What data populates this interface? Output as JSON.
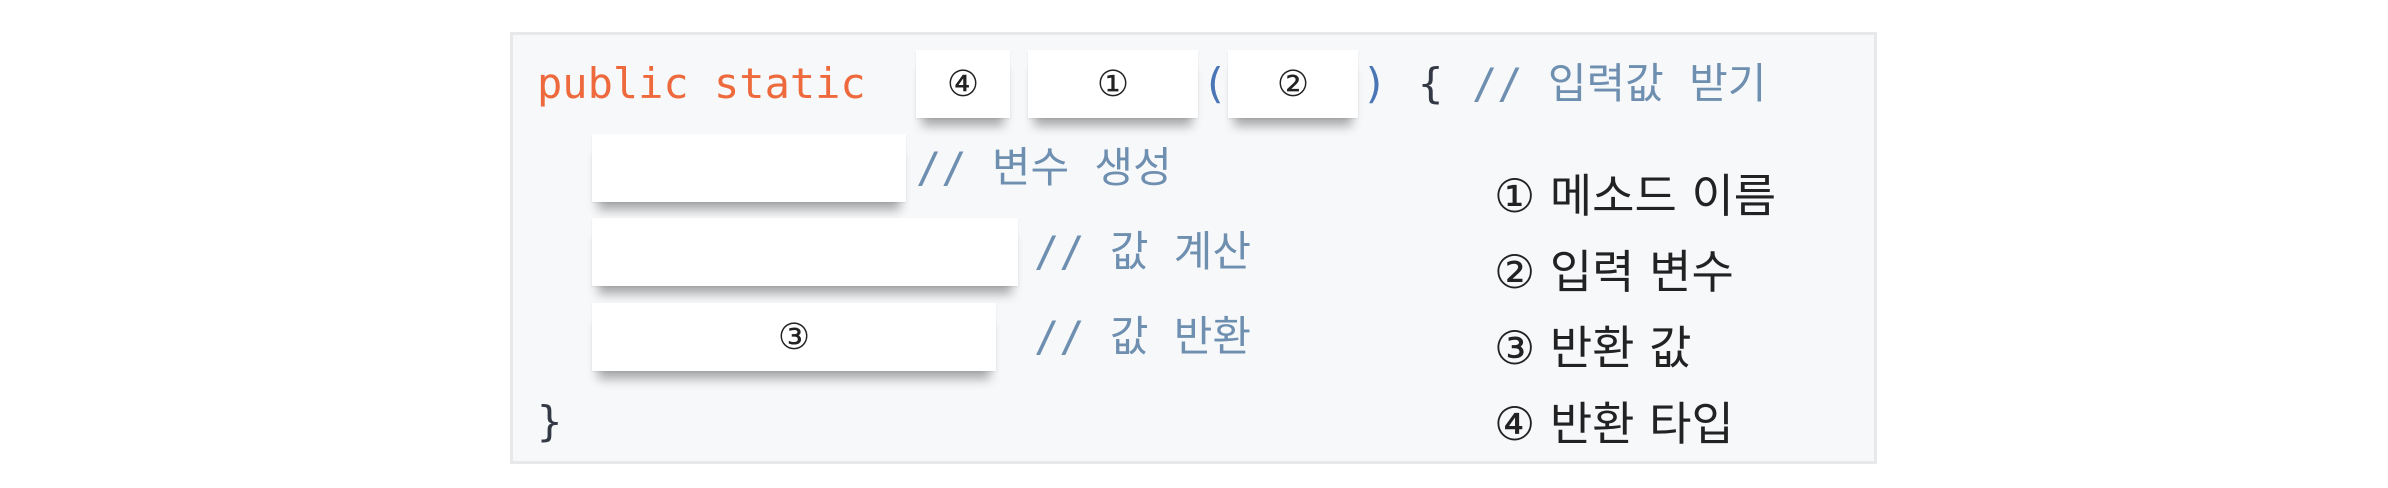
{
  "code": {
    "line1": {
      "keywords": "public static",
      "open_paren": "(",
      "close_paren": ")",
      "open_brace": "{",
      "comment": "// 입력값 받기"
    },
    "line2": {
      "comment": "// 변수 생성"
    },
    "line3": {
      "comment": "// 값 계산"
    },
    "line4": {
      "comment": "// 값 반환"
    },
    "closing_brace": "}"
  },
  "blanks": {
    "return_type_marker": "④",
    "method_name_marker": "①",
    "parameter_marker": "②",
    "return_value_marker": "③"
  },
  "legend": [
    "① 메소드 이름",
    "② 입력 변수",
    "③ 반환 값",
    "④ 반환 타입"
  ]
}
